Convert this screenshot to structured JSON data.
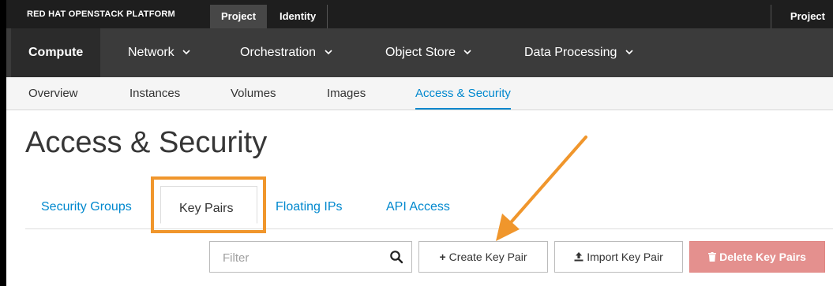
{
  "topbar": {
    "brand": "RED HAT OPENSTACK PLATFORM",
    "tabs": [
      {
        "label": "Project",
        "active": true
      },
      {
        "label": "Identity",
        "active": false
      }
    ],
    "right_label": "Project"
  },
  "nav": {
    "items": [
      {
        "label": "Compute",
        "active": true
      },
      {
        "label": "Network"
      },
      {
        "label": "Orchestration"
      },
      {
        "label": "Object Store"
      },
      {
        "label": "Data Processing"
      }
    ]
  },
  "subnav": {
    "items": [
      {
        "label": "Overview"
      },
      {
        "label": "Instances"
      },
      {
        "label": "Volumes"
      },
      {
        "label": "Images"
      },
      {
        "label": "Access & Security",
        "active": true
      }
    ]
  },
  "page": {
    "title": "Access & Security"
  },
  "tabs": [
    {
      "label": "Security Groups"
    },
    {
      "label": "Key Pairs",
      "active": true
    },
    {
      "label": "Floating IPs"
    },
    {
      "label": "API Access"
    }
  ],
  "toolbar": {
    "filter_placeholder": "Filter",
    "create_label": "Create Key Pair",
    "import_label": "Import Key Pair",
    "delete_label": "Delete Key Pairs"
  },
  "icons": {
    "search": "search-icon",
    "plus": "plus-icon",
    "upload": "upload-icon",
    "trash": "trash-icon",
    "chevron": "chevron-down-icon"
  },
  "colors": {
    "accent": "#0088ce",
    "highlight": "#f0962c",
    "danger": "#e4908e",
    "topbar": "#1e1e1e",
    "navbar": "#3b3b3b"
  }
}
